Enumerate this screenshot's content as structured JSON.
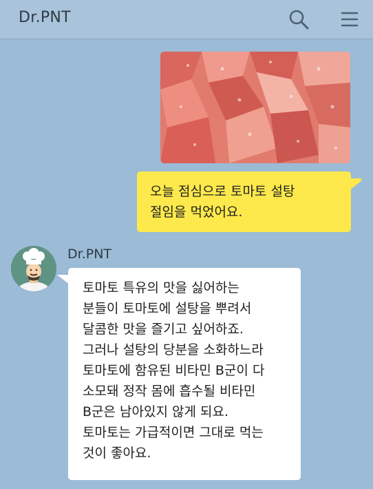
{
  "header": {
    "title": "Dr.PNT",
    "search_icon": "search-icon",
    "menu_icon": "hamburger-menu-icon"
  },
  "messages": {
    "photo": {
      "subject": "tomato-slices-with-sugar"
    },
    "user": {
      "lines": [
        "오늘 점심으로 토마토 설탕",
        "절임을 먹었어요."
      ]
    },
    "bot": {
      "sender": "Dr.PNT",
      "avatar_icon": "chef-avatar-icon",
      "lines": [
        "토마토 특유의 맛을 싫어하는",
        "분들이 토마토에 설탕을 뿌려서",
        "달콤한 맛을 즐기고 싶어하죠.",
        "그러나 설탕의 당분을 소화하느라",
        "토마토에 함유된 비타민 B군이 다",
        "소모돼 정작 몸에 흡수될 비타민",
        "B군은 남아있지 않게 되요.",
        "토마토는 가급적이면 그대로 먹는",
        "것이 좋아요."
      ]
    }
  },
  "colors": {
    "background": "#9bbbd6",
    "header": "#a9c3da",
    "user_bubble": "#fde94b",
    "bot_bubble": "#ffffff",
    "avatar_bg": "#5f9384"
  }
}
